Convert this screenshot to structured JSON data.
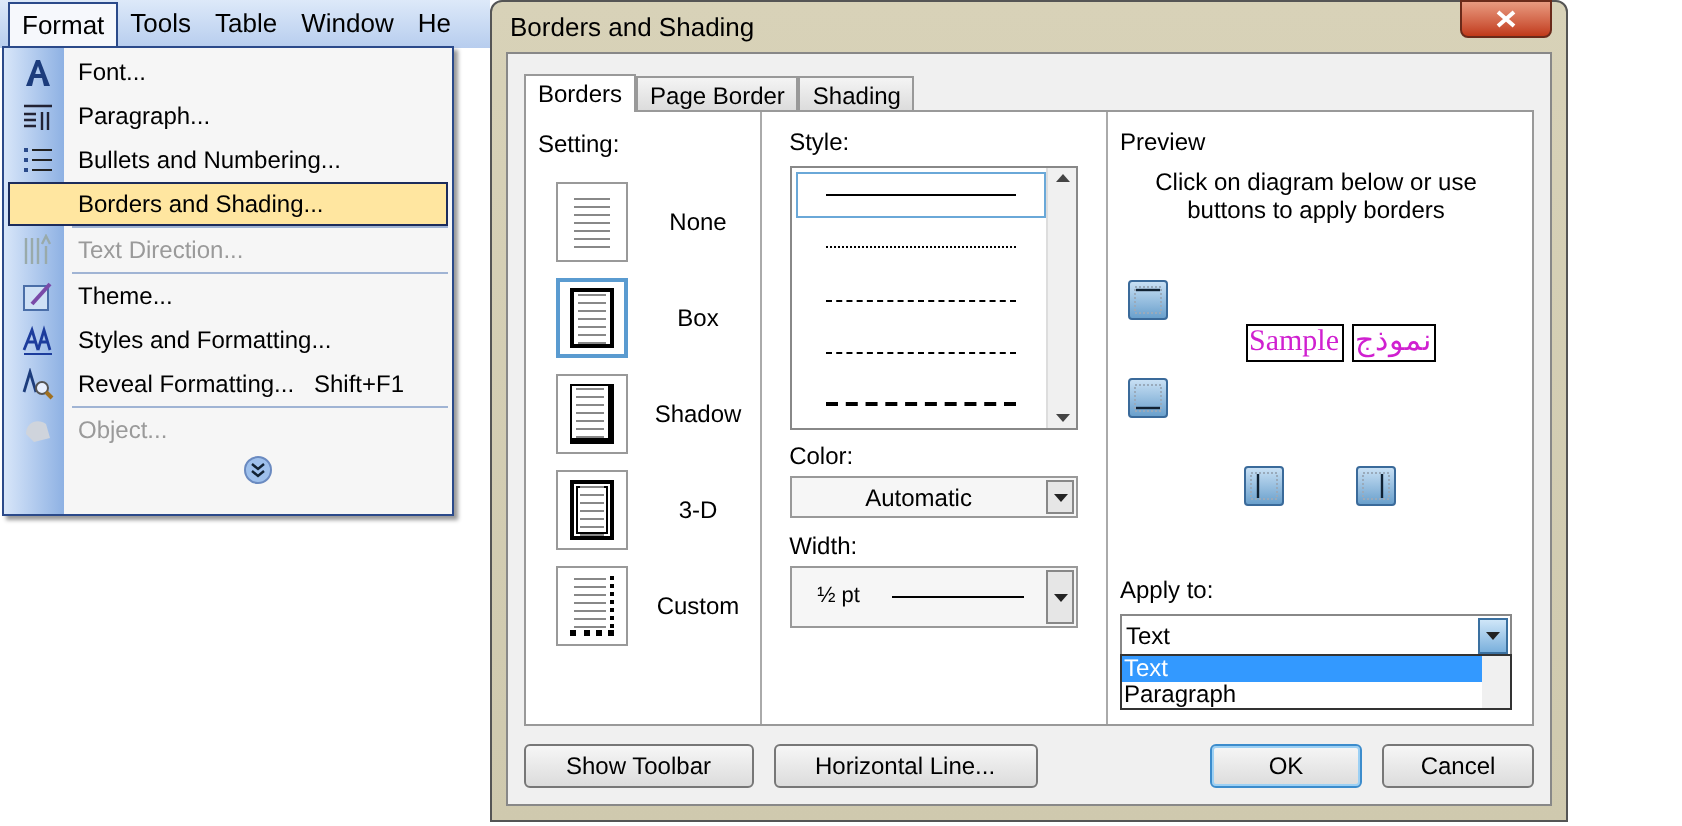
{
  "menu_bar": {
    "items": [
      {
        "label": "Format",
        "selected": true
      },
      {
        "label": "Tools",
        "selected": false
      },
      {
        "label": "Table",
        "selected": false
      },
      {
        "label": "Window",
        "selected": false
      },
      {
        "label": "He",
        "selected": false
      }
    ]
  },
  "format_menu": {
    "items": [
      {
        "kind": "command",
        "label": "Font...",
        "disabled": false,
        "selected": false
      },
      {
        "kind": "command",
        "label": "Paragraph...",
        "disabled": false,
        "selected": false
      },
      {
        "kind": "command",
        "label": "Bullets and Numbering...",
        "disabled": false,
        "selected": false
      },
      {
        "kind": "command",
        "label": "Borders and Shading...",
        "disabled": false,
        "selected": true
      },
      {
        "kind": "separator"
      },
      {
        "kind": "command",
        "label": "Text Direction...",
        "disabled": true,
        "selected": false
      },
      {
        "kind": "separator"
      },
      {
        "kind": "command",
        "label": "Theme...",
        "disabled": false,
        "selected": false
      },
      {
        "kind": "command",
        "label": "Styles and Formatting...",
        "disabled": false,
        "selected": false
      },
      {
        "kind": "command",
        "label": "Reveal Formatting...",
        "shortcut": "Shift+F1",
        "disabled": false,
        "selected": false
      },
      {
        "kind": "separator"
      },
      {
        "kind": "command",
        "label": "Object...",
        "disabled": true,
        "selected": false
      }
    ]
  },
  "dialog": {
    "title": "Borders and Shading",
    "tabs": [
      {
        "label": "Borders",
        "selected": true
      },
      {
        "label": "Page Border",
        "selected": false
      },
      {
        "label": "Shading",
        "selected": false
      }
    ],
    "setting": {
      "label": "Setting:",
      "options": [
        {
          "label": "None",
          "kind": "none",
          "selected": false
        },
        {
          "label": "Box",
          "kind": "box",
          "selected": true
        },
        {
          "label": "Shadow",
          "kind": "shadow",
          "selected": false
        },
        {
          "label": "3-D",
          "kind": "threed",
          "selected": false
        },
        {
          "label": "Custom",
          "kind": "custom",
          "selected": false
        }
      ]
    },
    "style": {
      "label": "Style:",
      "items": [
        {
          "kind": "solid",
          "selected": true
        },
        {
          "kind": "dotted",
          "selected": false
        },
        {
          "kind": "fine-dash",
          "selected": false
        },
        {
          "kind": "dash",
          "selected": false
        },
        {
          "kind": "long-dash",
          "selected": false
        }
      ]
    },
    "color": {
      "label": "Color:",
      "value": "Automatic"
    },
    "width": {
      "label": "Width:",
      "value": "½ pt"
    },
    "preview": {
      "label": "Preview",
      "hint": "Click on diagram below or use buttons to apply borders",
      "samples": [
        "Sample",
        "نموذج"
      ]
    },
    "apply_to": {
      "label": "Apply to:",
      "value": "Text",
      "options": [
        {
          "label": "Text",
          "selected": true
        },
        {
          "label": "Paragraph",
          "selected": false
        }
      ]
    },
    "buttons": [
      {
        "label": "Show Toolbar",
        "kind": "left",
        "default": false
      },
      {
        "label": "Horizontal Line...",
        "kind": "left",
        "default": false
      },
      {
        "label": "OK",
        "kind": "right",
        "default": true
      },
      {
        "label": "Cancel",
        "kind": "right",
        "default": false
      }
    ]
  }
}
